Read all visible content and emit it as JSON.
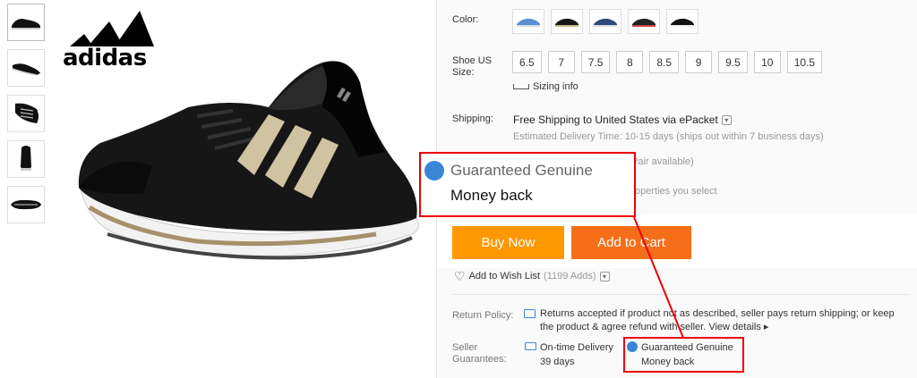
{
  "thumbnails": [
    "shoe-side-thumb",
    "shoe-angle-thumb",
    "shoe-top-thumb",
    "shoe-back-thumb",
    "shoe-sole-thumb"
  ],
  "brand": {
    "logo_text": "adidas"
  },
  "options": {
    "color_label": "Color:",
    "size_label": "Shoe US Size:",
    "sizes": [
      "6.5",
      "7",
      "7.5",
      "8",
      "8.5",
      "9",
      "9.5",
      "10",
      "10.5"
    ],
    "sizing_info": "Sizing info"
  },
  "shipping": {
    "label": "Shipping:",
    "main": "Free Shipping to United States via ePacket",
    "estimate": "Estimated Delivery Time: 10-15 days (ships out within 7 business days)",
    "available": "Pair available)",
    "properties": "operties you select"
  },
  "actions": {
    "buy_now": "Buy Now",
    "add_to_cart": "Add to Cart",
    "wishlist": "Add to Wish List",
    "wishlist_count": "(1199 Adds)"
  },
  "policy": {
    "label": "Return Policy:",
    "text": "Returns accepted if product not as described, seller pays return shipping; or keep the product & agree refund with seller.",
    "view_details": "View details"
  },
  "guarantees": {
    "label": "Seller Guarantees:",
    "ontime_title": "On-time Delivery",
    "ontime_days": "39 days",
    "genuine_title": "Guaranteed Genuine",
    "genuine_sub": "Money back"
  },
  "colors": {
    "accent_orange": "#ff9800",
    "cart_orange": "#f56f1a",
    "highlight_red": "#ee0000",
    "badge_blue": "#3a86d6"
  }
}
